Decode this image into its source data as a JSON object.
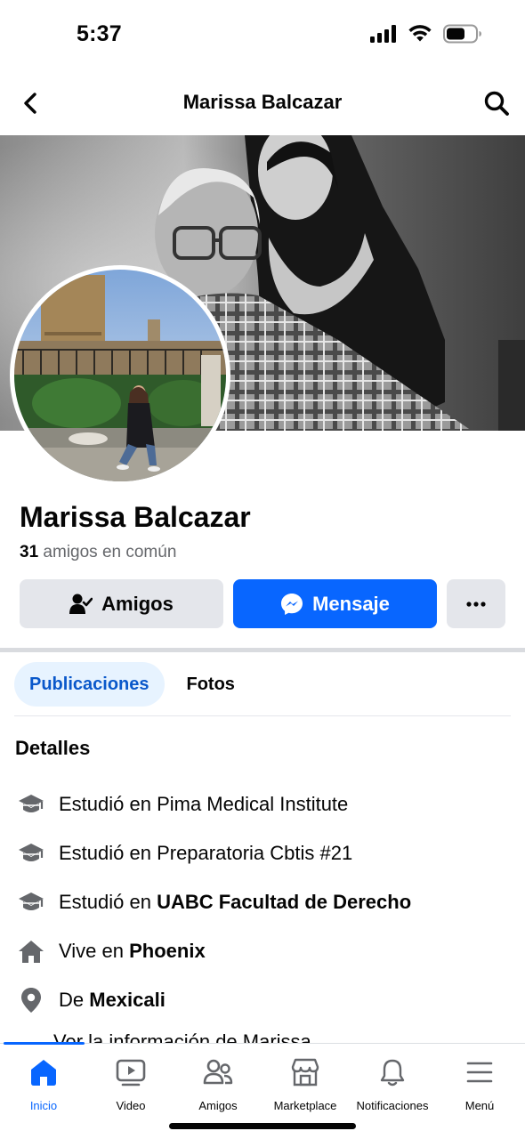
{
  "status_bar": {
    "time": "5:37"
  },
  "navbar": {
    "title": "Marissa Balcazar",
    "back_icon": "chevron-left-icon",
    "search_icon": "search-icon"
  },
  "profile": {
    "name": "Marissa Balcazar",
    "mutual_count": "31",
    "mutual_text": "amigos en común"
  },
  "actions": {
    "friends_label": "Amigos",
    "message_label": "Mensaje",
    "more_label": "..."
  },
  "tabs": [
    {
      "label": "Publicaciones",
      "active": true
    },
    {
      "label": "Fotos",
      "active": false
    }
  ],
  "details": {
    "title": "Detalles",
    "items": [
      {
        "icon": "graduation-cap-icon",
        "prefix": "Estudió en Pima Medical Institute",
        "bold": ""
      },
      {
        "icon": "graduation-cap-icon",
        "prefix": "Estudió en Preparatoria Cbtis #21",
        "bold": ""
      },
      {
        "icon": "graduation-cap-icon",
        "prefix": "Estudió en ",
        "bold": "UABC Facultad de Derecho"
      },
      {
        "icon": "house-icon",
        "prefix": "Vive en ",
        "bold": "Phoenix"
      },
      {
        "icon": "location-pin-icon",
        "prefix": "De ",
        "bold": "Mexicali"
      }
    ],
    "partial_line": "Ver la información de Marissa"
  },
  "bottom_tabs": [
    {
      "label": "Inicio",
      "icon": "home-icon",
      "active": true
    },
    {
      "label": "Video",
      "icon": "video-icon",
      "active": false
    },
    {
      "label": "Amigos",
      "icon": "friends-icon",
      "active": false
    },
    {
      "label": "Marketplace",
      "icon": "marketplace-icon",
      "active": false
    },
    {
      "label": "Notificaciones",
      "icon": "bell-icon",
      "active": false
    },
    {
      "label": "Menú",
      "icon": "menu-icon",
      "active": false
    }
  ],
  "colors": {
    "accent": "#0866ff",
    "button_gray": "#e4e6eb",
    "secondary_text": "#65676b",
    "active_tab_bg": "#e7f3ff"
  }
}
